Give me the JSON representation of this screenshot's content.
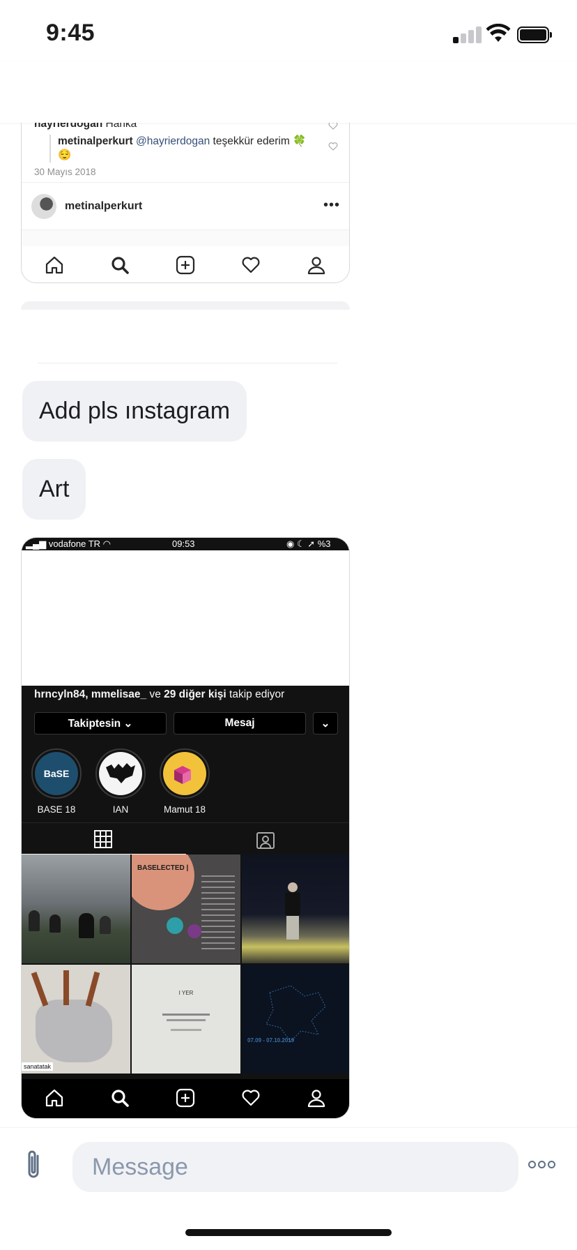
{
  "status_bar": {
    "time": "9:45"
  },
  "attachment_top": {
    "prev_comment": {
      "user": "hayrierdogan",
      "text": "Harika"
    },
    "reply": {
      "user": "metinalperkurt",
      "mention": "@hayrierdogan",
      "text": "teşekkür ederim 🍀😌"
    },
    "date": "30 Mayıs 2018",
    "account_name": "metinalperkurt",
    "more": "•••"
  },
  "messages": [
    {
      "text": "Add pls ınstagram"
    },
    {
      "text": "Art"
    }
  ],
  "attachment_profile": {
    "status": {
      "carrier": "vodafone TR",
      "time": "09:53",
      "battery": "%3"
    },
    "followed_by": {
      "users": "hrncyln84, mmelisae_",
      "connector": "ve",
      "others": "29 diğer kişi",
      "suffix": "takip ediyor"
    },
    "buttons": {
      "following": "Takiptesin ⌄",
      "message": "Mesaj",
      "dropdown": "⌄"
    },
    "highlights": [
      {
        "label": "BASE 18",
        "cover_text": "BaSE"
      },
      {
        "label": "IAN",
        "cover_text": ""
      },
      {
        "label": "Mamut 18",
        "cover_text": ""
      }
    ],
    "grid_texts": {
      "post2_title": "BASELECTED |",
      "post4_tag": "sanatatak",
      "post5_label": "I YER",
      "post6_dates": "07.09 - 07.10.2019"
    }
  },
  "composer": {
    "placeholder": "Message"
  },
  "colors": {
    "bubble_bg": "#eff1f4",
    "mention": "#34507a",
    "placeholder": "#8a98ad",
    "ig_dark": "#121212"
  }
}
